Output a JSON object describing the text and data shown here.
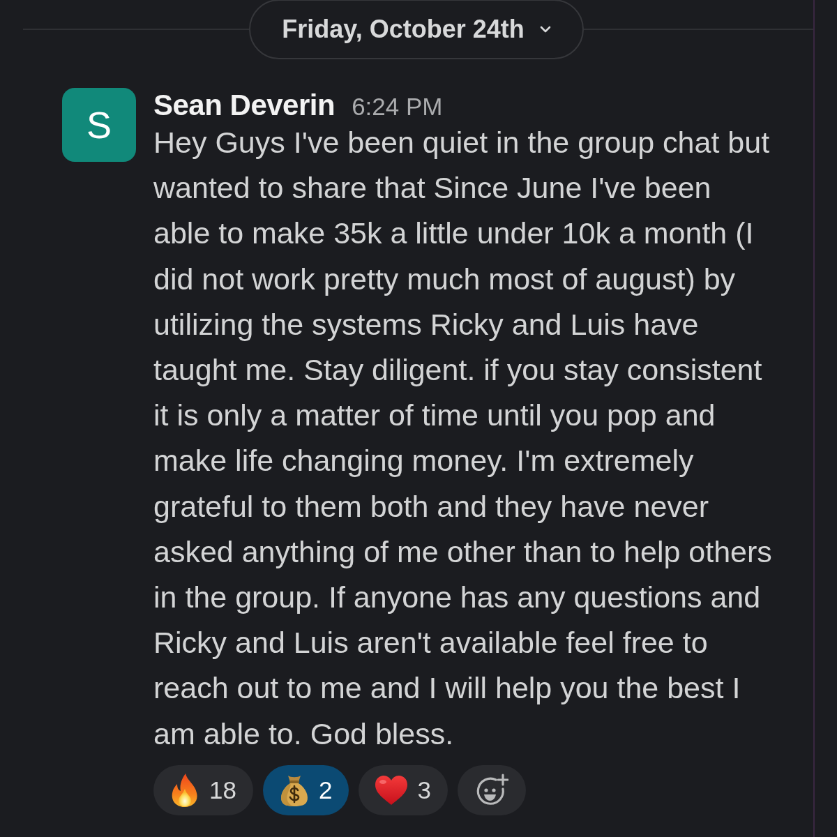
{
  "date_divider": {
    "label": "Friday, October 24th"
  },
  "message": {
    "avatar_initial": "S",
    "author": "Sean Deverin",
    "time": "6:24 PM",
    "text": "Hey Guys I've been quiet in the group chat but wanted to share that Since June I've been able to make 35k a little under 10k a month (I did not work pretty much most of august) by utilizing the systems Ricky and Luis have taught me. Stay diligent. if you stay consistent it is only a matter of time until you pop and make life changing money. I'm extremely grateful to them both and they have never asked anything of me other than to help others in the group. If anyone has any questions and Ricky and Luis aren't available feel free to reach out to me and I will help you the best I am able to. God bless."
  },
  "reactions": [
    {
      "kind": "fire",
      "count": "18",
      "selected": false
    },
    {
      "kind": "money_bag",
      "count": "2",
      "selected": true
    },
    {
      "kind": "heart",
      "count": "3",
      "selected": false
    }
  ]
}
